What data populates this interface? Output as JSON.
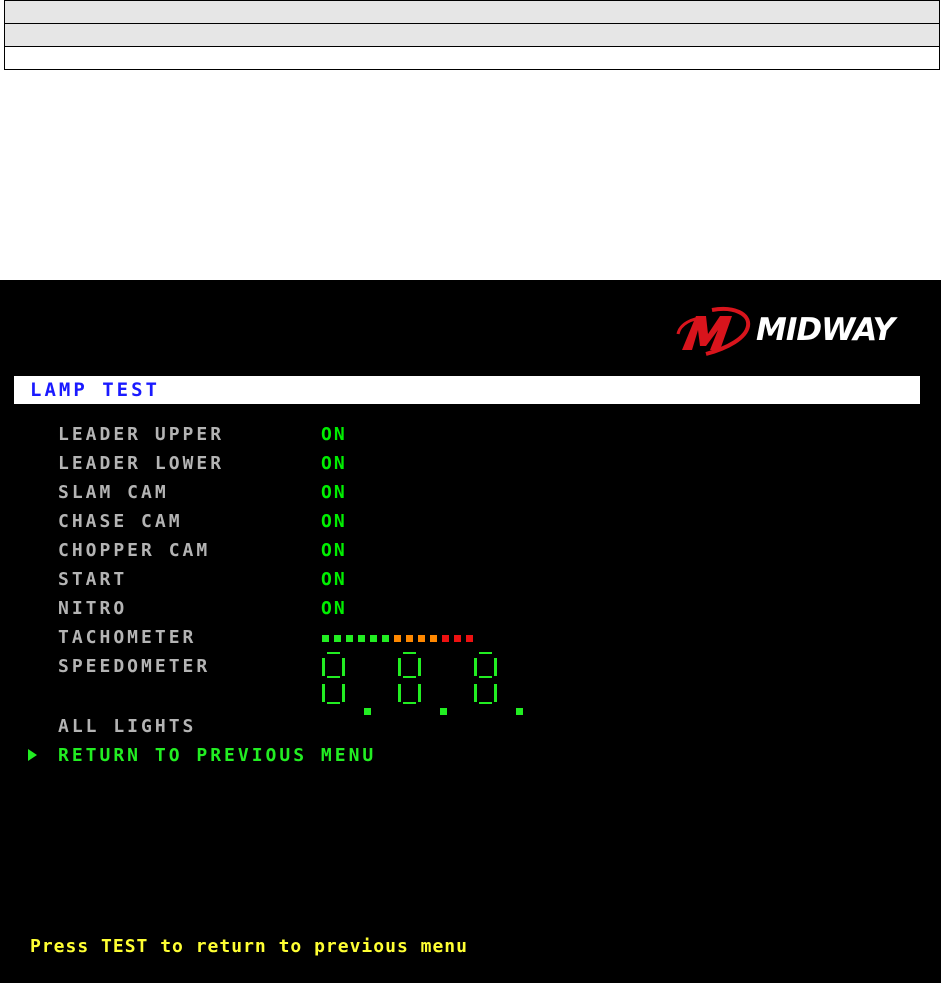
{
  "logo": {
    "text": "MIDWAY",
    "icon": "midway-mw-icon",
    "accent": "#d8141c"
  },
  "screen": {
    "title": "LAMP TEST",
    "items": [
      {
        "label": "LEADER UPPER",
        "value": "ON"
      },
      {
        "label": "LEADER LOWER",
        "value": "ON"
      },
      {
        "label": "SLAM CAM",
        "value": "ON"
      },
      {
        "label": "CHASE CAM",
        "value": "ON"
      },
      {
        "label": "CHOPPER CAM",
        "value": "ON"
      },
      {
        "label": "START",
        "value": "ON"
      },
      {
        "label": "NITRO",
        "value": "ON"
      },
      {
        "label": "TACHOMETER"
      },
      {
        "label": "SPEEDOMETER"
      },
      {
        "label": "ALL LIGHTS"
      }
    ],
    "selected_item": "RETURN TO PREVIOUS MENU",
    "footer": "Press TEST to return to previous menu"
  },
  "tachometer": {
    "segment_colors": [
      "#22ee22",
      "#22ee22",
      "#22ee22",
      "#22ee22",
      "#22ee22",
      "#22ee22",
      "#ff8800",
      "#ff8800",
      "#ff8800",
      "#ff8800",
      "#ee1111",
      "#ee1111",
      "#ee1111"
    ]
  },
  "speedometer": {
    "digits": [
      "8",
      "8",
      "8"
    ],
    "color": "#22ee22"
  },
  "colors": {
    "on": "#00ee00",
    "label": "#b4b4b4",
    "title": "#1a1aff",
    "footer": "#ffff33"
  }
}
